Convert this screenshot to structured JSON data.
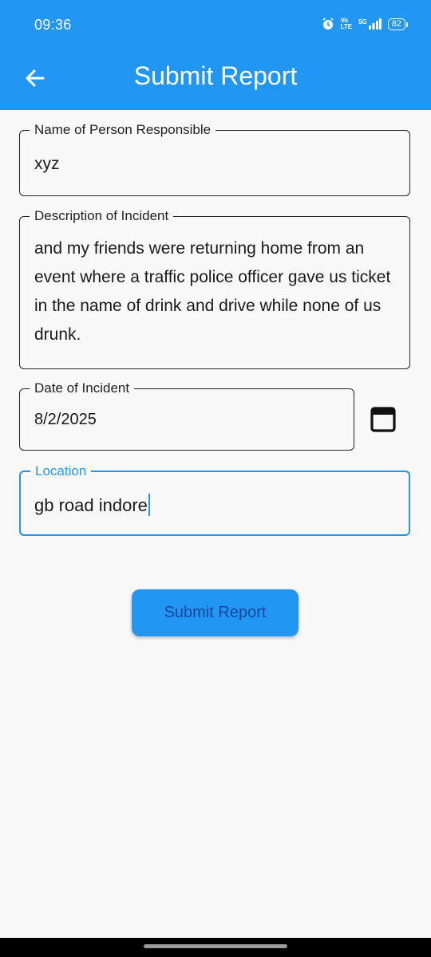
{
  "status_bar": {
    "time": "09:36",
    "network_top": "Vo",
    "network_bottom": "LTE",
    "signal_label": "5G",
    "battery": "82"
  },
  "app_bar": {
    "title": "Submit Report",
    "back_icon": "arrow-left-icon",
    "color": "#2196f3"
  },
  "form": {
    "name": {
      "label": "Name of Person Responsible",
      "value": "xyz"
    },
    "description": {
      "label": "Description of Incident",
      "value": "and my friends were returning home from an event where a traffic police officer gave us ticket in the name of drink and drive while none of us drunk."
    },
    "date": {
      "label": "Date of Incident",
      "value": "8/2/2025",
      "picker_icon": "calendar-icon"
    },
    "location": {
      "label": "Location",
      "value": "gb road indore",
      "focused": true
    }
  },
  "submit_button": {
    "label": "Submit Report"
  }
}
